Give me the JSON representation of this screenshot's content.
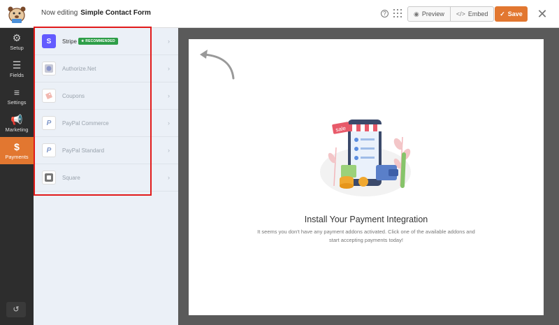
{
  "header": {
    "editing_label": "Now editing",
    "form_name": "Simple Contact Form",
    "preview_label": "Preview",
    "embed_label": "Embed",
    "save_label": "Save"
  },
  "nav": {
    "items": [
      {
        "label": "Setup",
        "icon": "gear-icon"
      },
      {
        "label": "Fields",
        "icon": "list-icon"
      },
      {
        "label": "Settings",
        "icon": "sliders-icon"
      },
      {
        "label": "Marketing",
        "icon": "megaphone-icon"
      },
      {
        "label": "Payments",
        "icon": "dollar-icon"
      }
    ]
  },
  "payments": {
    "items": [
      {
        "label": "Stripe",
        "badge": "★ RECOMMENDED"
      },
      {
        "label": "Authorize.Net"
      },
      {
        "label": "Coupons"
      },
      {
        "label": "PayPal Commerce"
      },
      {
        "label": "PayPal Standard"
      },
      {
        "label": "Square"
      }
    ]
  },
  "main": {
    "sale_tag": "sale",
    "title": "Install Your Payment Integration",
    "description": "It seems you don't have any payment addons activated. Click one of the available addons and start accepting payments today!"
  },
  "colors": {
    "accent": "#e27730",
    "nav_bg": "#2d2d2d",
    "panel_bg": "#ebf0f7",
    "highlight": "#e11a1a",
    "badge": "#2e9e48"
  }
}
